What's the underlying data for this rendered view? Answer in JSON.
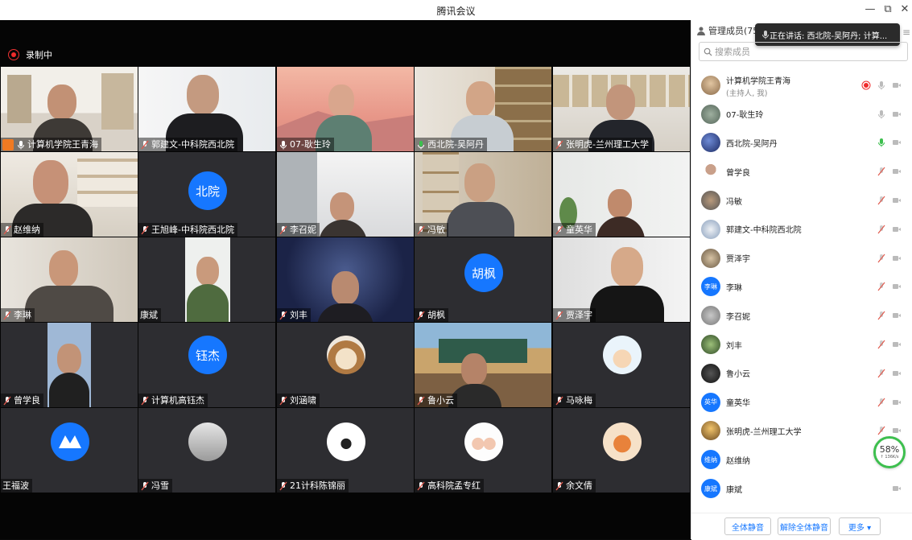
{
  "window": {
    "title": "腾讯会议",
    "minimize": "—",
    "restore": "⧉",
    "close": "✕"
  },
  "recording": {
    "label": "录制中"
  },
  "tiles": [
    "计算机学院王青海",
    "郭建文-中科院西北院",
    "07-耿生玲",
    "西北院-吴阿丹",
    "张明虎-兰州理工大学",
    "赵维纳",
    "王旭峰-中科院西北院",
    "李召妮",
    "冯敏",
    "童英华",
    "李琳",
    "康斌",
    "刘丰",
    "胡枫",
    "贾泽宇",
    "曾学良",
    "计算机高钰杰",
    "刘涵啸",
    "鲁小云",
    "马咏梅",
    "王福波",
    "冯雪",
    "21计科陈锦丽",
    "高科院孟专红",
    "余文倩"
  ],
  "avatar_text": {
    "wangxufeng": "北院",
    "hufeng": "胡枫",
    "gaoyujie": "钰杰"
  },
  "panel": {
    "title": "管理成员(75)",
    "speaking": "正在讲话: 西北院-吴阿丹; 计算...",
    "search_placeholder": "搜索成员",
    "members": [
      {
        "name": "计算机学院王青海",
        "sub": "(主持人, 我)"
      },
      {
        "name": "07-耿生玲"
      },
      {
        "name": "西北院-吴阿丹"
      },
      {
        "name": "曾学良"
      },
      {
        "name": "冯敏"
      },
      {
        "name": "郭建文-中科院西北院"
      },
      {
        "name": "贾泽宇"
      },
      {
        "name": "李琳",
        "avatar": "李琳"
      },
      {
        "name": "李召妮"
      },
      {
        "name": "刘丰"
      },
      {
        "name": "鲁小云"
      },
      {
        "name": "童英华",
        "avatar": "英华"
      },
      {
        "name": "张明虎-兰州理工大学"
      },
      {
        "name": "赵维纳",
        "avatar": "维纳"
      },
      {
        "name": "康斌",
        "avatar": "康斌"
      }
    ],
    "network": {
      "percent": "58%",
      "speed": "↑ 136K/s"
    },
    "buttons": {
      "mute_all": "全体静音",
      "unmute_all": "解除全体静音",
      "more": "更多 ▾"
    }
  },
  "colors": {
    "accent": "#1677ff",
    "record": "#ef2b2b",
    "speaking_green": "#3dbf4e",
    "muted_red": "#e05a4e"
  }
}
